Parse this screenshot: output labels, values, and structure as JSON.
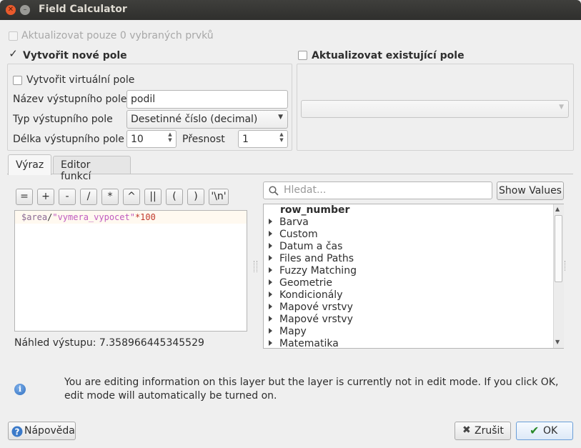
{
  "window": {
    "title": "Field Calculator"
  },
  "update_selected": {
    "label": "Aktualizovat pouze 0 vybraných prvků"
  },
  "create_new": {
    "label": "Vytvořit nové pole",
    "virtual_label": "Vytvořit virtuální pole",
    "name_label": "Název výstupního pole",
    "name_value": "podil",
    "type_label": "Typ výstupního pole",
    "type_value": "Desetinné číslo (decimal)",
    "length_label": "Délka výstupního pole",
    "length_value": "10",
    "precision_label": "Přesnost",
    "precision_value": "1"
  },
  "update_existing": {
    "label": "Aktualizovat existující pole"
  },
  "tabs": [
    {
      "label": "Výraz"
    },
    {
      "label": "Editor funkcí"
    }
  ],
  "operators": [
    "=",
    "+",
    "-",
    "/",
    "*",
    "^",
    "||",
    "(",
    ")",
    "'\\n'"
  ],
  "expression": {
    "part1": "$area",
    "part2": "/",
    "part3": "\"vymera_vypocet\"",
    "part4": "*100"
  },
  "preview": "Náhled výstupu: 7.358966445345529",
  "search": {
    "placeholder": "Hledat..."
  },
  "show_values_label": "Show Values",
  "functions": [
    "row_number",
    "Barva",
    "Custom",
    "Datum a čas",
    "Files and Paths",
    "Fuzzy Matching",
    "Geometrie",
    "Kondicionály",
    "Mapové vrstvy",
    "Mapové vrstvy",
    "Mapy",
    "Matematika"
  ],
  "info_message": "You are editing information on this layer but the layer is currently not in edit mode. If you click OK, edit mode will automatically be turned on.",
  "buttons": {
    "help": "Nápověda",
    "cancel": "Zrušit",
    "ok": "OK"
  },
  "colors": {
    "accent": "#e95a2c",
    "info": "#3b7ac9",
    "expr_keyword": "#8b6b94",
    "expr_string": "#c05bc0",
    "expr_number": "#c0392b"
  }
}
